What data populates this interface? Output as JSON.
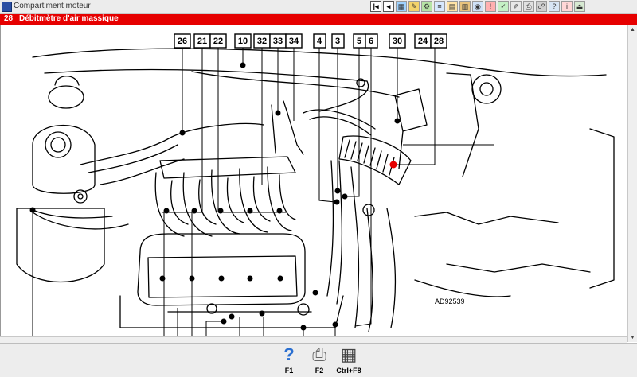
{
  "window": {
    "title": "Compartiment moteur"
  },
  "section": {
    "number": "28",
    "title": "Débitmètre d'air massique"
  },
  "toolbar": {
    "icons": [
      "previous-icon",
      "back-icon",
      "image-icon",
      "tools-icon",
      "settings-icon",
      "list-icon",
      "document-icon",
      "data-icon",
      "camera-icon",
      "warning-icon",
      "check-icon",
      "edit-icon",
      "print-icon",
      "network-icon",
      "help-icon",
      "info-icon",
      "exit-icon"
    ]
  },
  "diagram": {
    "reference_code": "AD92539",
    "callouts": [
      "26",
      "21",
      "22",
      "10",
      "32",
      "33",
      "34",
      "4",
      "3",
      "5",
      "6",
      "30",
      "24",
      "28"
    ],
    "accent_color": "#e60000"
  },
  "function_keys": [
    {
      "key": "F1",
      "icon": "help-question-icon"
    },
    {
      "key": "F2",
      "icon": "printer-icon"
    },
    {
      "key": "Ctrl+F8",
      "icon": "table-icon"
    }
  ]
}
